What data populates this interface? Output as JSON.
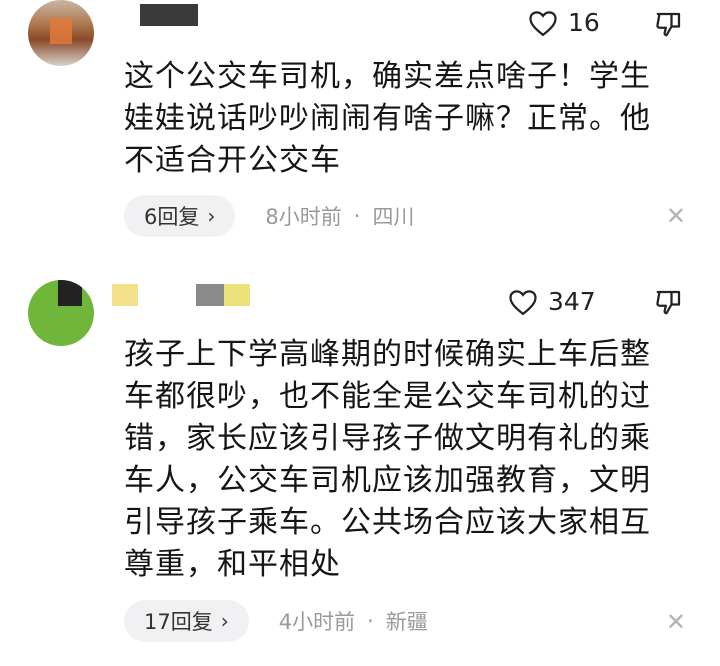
{
  "comments": [
    {
      "like_count": "16",
      "text": "这个公交车司机，确实差点啥子！学生娃娃说话吵吵闹闹有啥子嘛？正常。他不适合开公交车",
      "reply_label": "6回复",
      "time": "8小时前",
      "separator": "·",
      "location": "四川"
    },
    {
      "like_count": "347",
      "text": "孩子上下学高峰期的时候确实上车后整车都很吵，也不能全是公交车司机的过错，家长应该引导孩子做文明有礼的乘车人，公交车司机应该加强教育，文明引导孩子乘车。公共场合应该大家相互尊重，和平相处",
      "reply_label": "17回复",
      "time": "4小时前",
      "separator": "·",
      "location": "新疆"
    }
  ],
  "icons": {
    "chevron": "›",
    "close": "✕"
  }
}
